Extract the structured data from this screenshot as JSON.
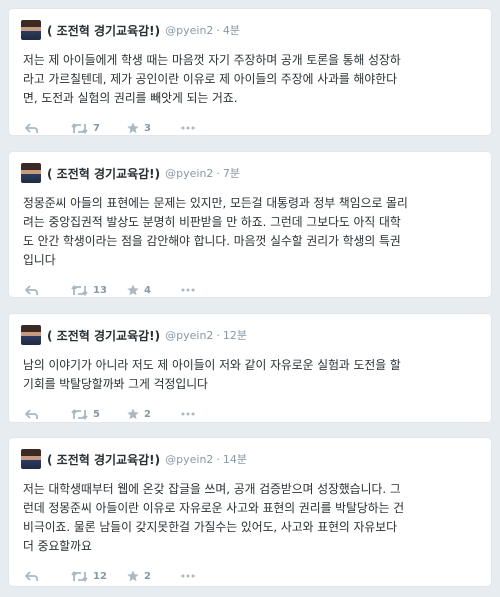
{
  "tweets": [
    {
      "display_name": "( 조전혁 경기교육감!)",
      "handle": "@pyein2",
      "time": "4분",
      "text": "저는 제 아이들에게 학생 때는 마음껏 자기 주장하며 공개  토론을 통해 성장하\n라고 가르칠텐데, 제가 공인이란 이유로 제 아이들의 주장에 사과를 해야한다\n면, 도전과 실험의 권리를 빼앗게 되는 거죠.",
      "retweets": "7",
      "favorites": "3"
    },
    {
      "display_name": "( 조전혁 경기교육감!)",
      "handle": "@pyein2",
      "time": "7분",
      "text": "정몽준씨 아들의 표현에는 문제는 있지만, 모든걸 대통령과 정부 책임으로 몰리\n려는 중앙집권적 발상도 분명히 비판받을 만 하죠. 그런데 그보다도 아직 대학\n도 안간 학생이라는 점을 감안해야 합니다. 마음껏 실수할 권리가 학생의 특권\n입니다",
      "retweets": "13",
      "favorites": "4"
    },
    {
      "display_name": "( 조전혁 경기교육감!)",
      "handle": "@pyein2",
      "time": "12분",
      "text": "남의 이야기가 아니라 저도 제 아이들이 저와 같이 자유로운 실험과 도전을 할\n기회를 박탈당할까봐 그게 걱정입니다",
      "retweets": "5",
      "favorites": "2"
    },
    {
      "display_name": "( 조전혁 경기교육감!)",
      "handle": "@pyein2",
      "time": "14분",
      "text": "저는 대학생때부터 웹에 온갖 잡글을 쓰며, 공개 검증받으며 성장했습니다. 그\n런데 정몽준씨 아들이란 이유로 자유로운 사고와 표현의 권리를 박탈당하는 건\n비극이죠. 물론 남들이 갖지못한걸 가질수는 있어도, 사고와 표현의 자유보다\n더 중요할까요",
      "retweets": "12",
      "favorites": "2"
    }
  ],
  "colors": {
    "background": "#e6ecf0",
    "card": "#ffffff",
    "text": "#292f33",
    "muted": "#8899a6",
    "action_icon": "#aab8c2"
  },
  "icons": {
    "reply": "reply-icon",
    "retweet": "retweet-icon",
    "favorite": "star-icon",
    "more": "more-dots-icon"
  }
}
